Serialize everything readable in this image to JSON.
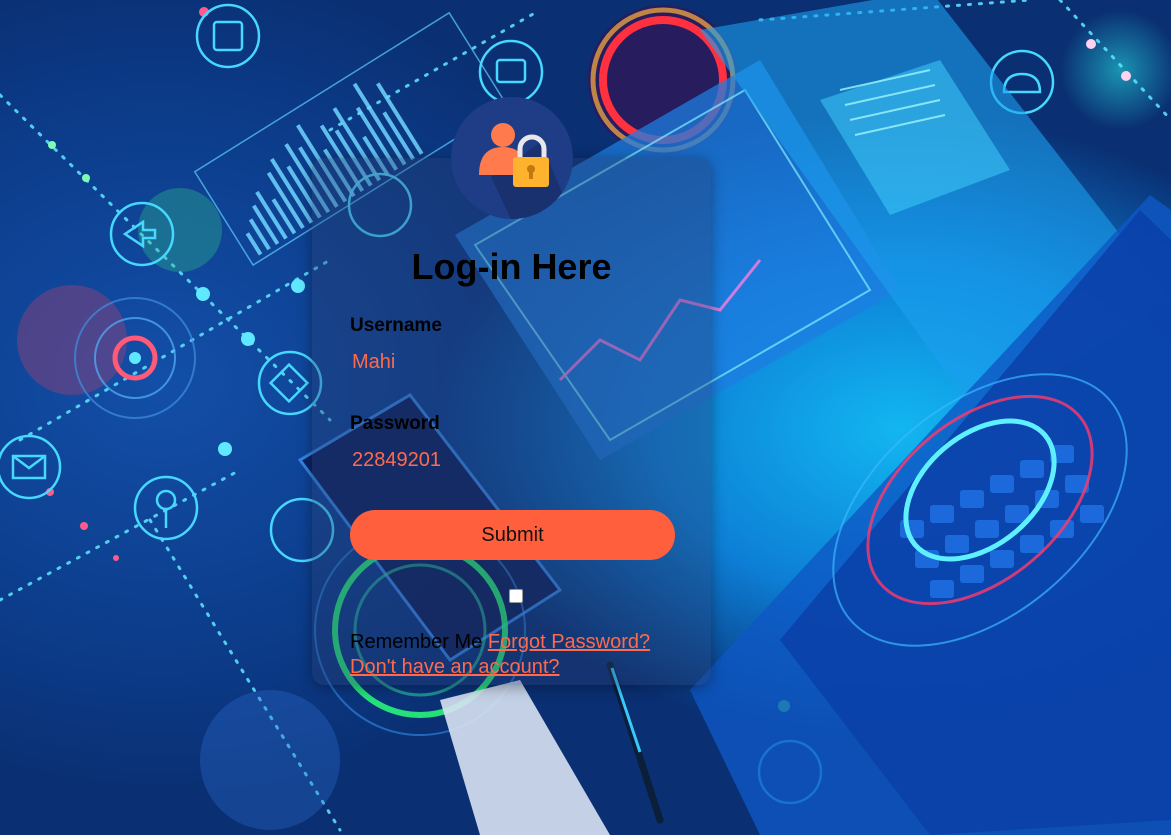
{
  "form": {
    "title": "Log-in Here",
    "username_label": "Username",
    "username_value": "Mahi",
    "password_label": "Password",
    "password_value": "22849201",
    "submit_label": "Submit",
    "remember_label": "Remember Me",
    "forgot_link": "Forgot Password?",
    "signup_link": "Don't have an account?"
  },
  "icons": {
    "avatar": "user-lock-icon"
  },
  "colors": {
    "accent": "#ff5f3c",
    "link": "#ff6a4d",
    "avatar_bg": "#1f3c86"
  }
}
